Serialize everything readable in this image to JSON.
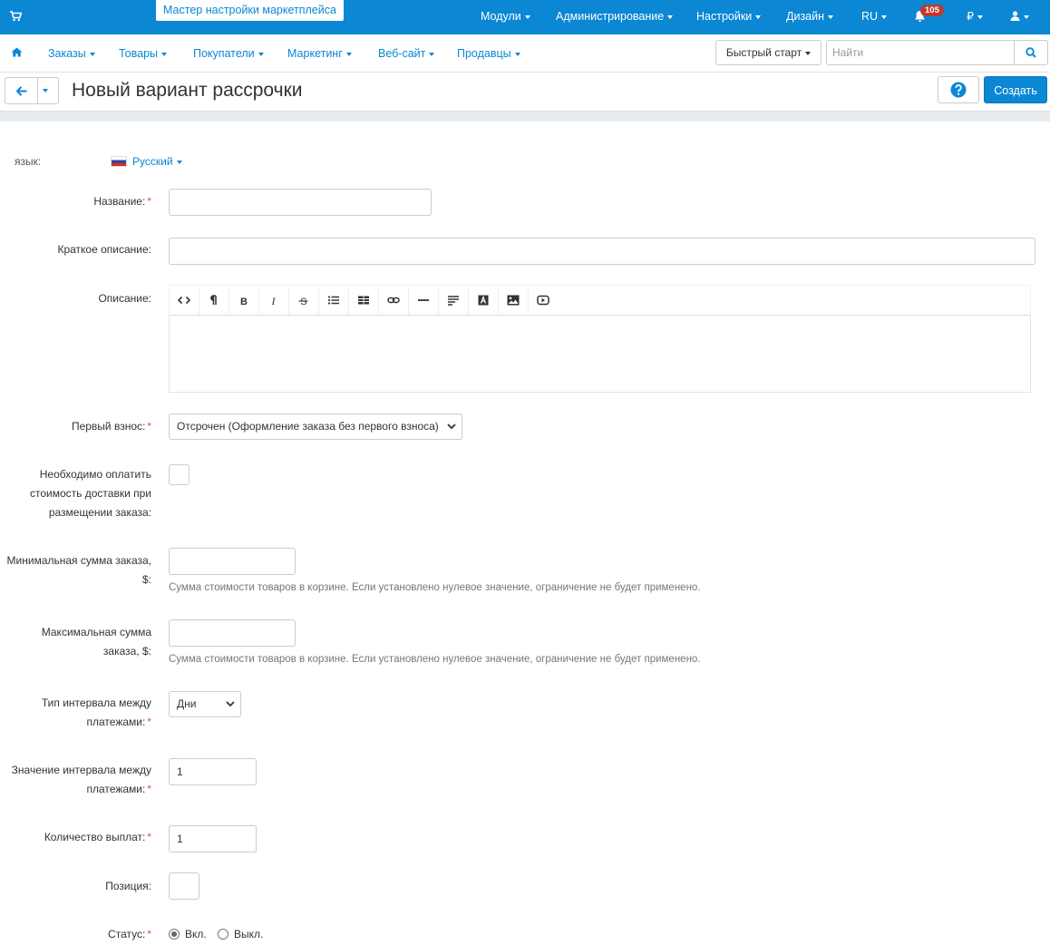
{
  "topbar": {
    "wizard_label": "Мастер настройки маркетплейса",
    "menus": [
      "Модули",
      "Администрирование",
      "Настройки",
      "Дизайн",
      "RU"
    ],
    "notifications_count": "105",
    "currency": "₽"
  },
  "nav": {
    "items": [
      "Заказы",
      "Товары",
      "Покупатели",
      "Маркетинг",
      "Веб-сайт",
      "Продавцы"
    ],
    "quick_start": "Быстрый старт",
    "search_placeholder": "Найти"
  },
  "toolbar": {
    "title": "Новый вариант рассрочки",
    "create_label": "Создать"
  },
  "form": {
    "language_label": "язык:",
    "language_value": "Русский",
    "name_label": "Название:",
    "short_desc_label": "Краткое описание:",
    "description_label": "Описание:",
    "first_payment_label": "Первый взнос:",
    "first_payment_value": "Отсрочен (Оформление заказа без первого взноса)",
    "shipping_label": "Необходимо оплатить стоимость доставки при размещении заказа:",
    "min_sum_label": "Минимальная сумма заказа, $:",
    "min_sum_hint": "Сумма стоимости товаров в корзине. Если установлено нулевое значение, ограничение не будет применено.",
    "max_sum_label": "Максимальная сумма заказа, $:",
    "max_sum_hint": "Сумма стоимости товаров в корзине. Если установлено нулевое значение, ограничение не будет применено.",
    "interval_type_label": "Тип интервала между платежами:",
    "interval_type_value": "Дни",
    "interval_value_label": "Значение интервала между платежами:",
    "interval_value": "1",
    "payments_count_label": "Количество выплат:",
    "payments_count": "1",
    "position_label": "Позиция:",
    "status_label": "Статус:",
    "status_on": "Вкл.",
    "status_off": "Выкл."
  },
  "colors": {
    "primary": "#0b87d3",
    "required": "#d9534f",
    "badge": "#c0392b"
  },
  "icons": [
    "cart-icon",
    "bell-icon",
    "user-icon",
    "home-icon",
    "search-icon",
    "arrow-left-icon",
    "question-icon",
    "code-icon",
    "paragraph-icon",
    "bold-icon",
    "italic-icon",
    "strikethrough-icon",
    "list-icon",
    "table-icon",
    "link-icon",
    "horizontal-rule-icon",
    "align-icon",
    "text-color-icon",
    "image-icon",
    "video-icon",
    "russia-flag-icon"
  ]
}
